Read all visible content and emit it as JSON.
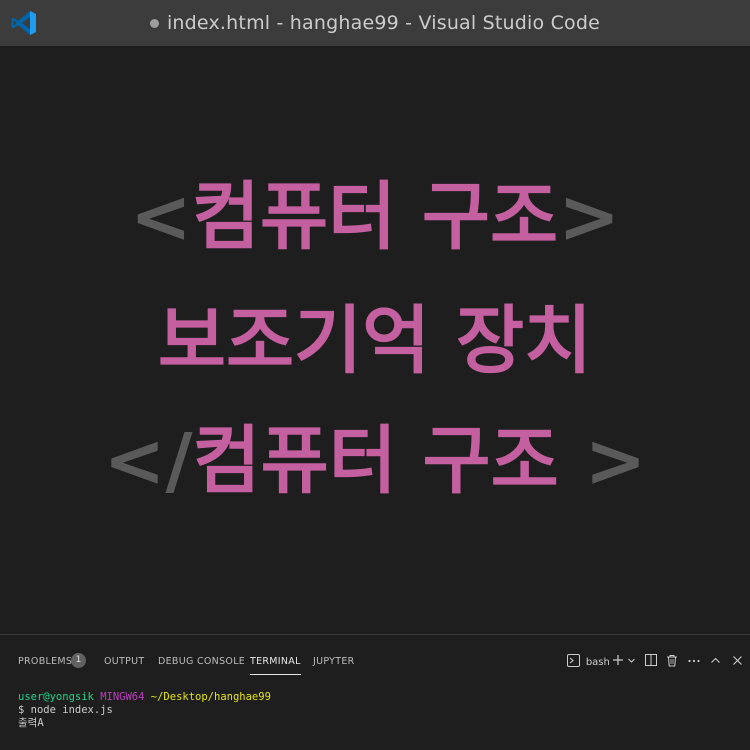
{
  "window": {
    "title": "index.html - hanghae99 - Visual Studio Code"
  },
  "editor": {
    "line1": {
      "open": "<",
      "text": "컴퓨터 구조",
      "close": ">"
    },
    "line2": {
      "text": "보조기억 장치"
    },
    "line3": {
      "open": "</",
      "text": "컴퓨터 구조",
      "close": " >"
    }
  },
  "panel": {
    "tabs": [
      {
        "label": "PROBLEMS"
      },
      {
        "label": "OUTPUT"
      },
      {
        "label": "DEBUG CONSOLE"
      },
      {
        "label": "TERMINAL"
      },
      {
        "label": "JUPYTER"
      }
    ],
    "problems_count": "1",
    "active_tab": "TERMINAL",
    "shell": "bash"
  },
  "terminal": {
    "user": "user@yongsik",
    "host": "MINGW64",
    "path": "~/Desktop/hanghae99",
    "command": "$ node index.js",
    "output": "출력A"
  },
  "colors": {
    "accent_pink": "#c45fa0",
    "bracket_gray": "#5a5a5a",
    "editor_bg": "#1e1e1e",
    "titlebar_bg": "#3c3c3c"
  },
  "icons": [
    "vscode-logo",
    "unsaved-dot-icon",
    "terminal-icon",
    "plus-icon",
    "chevron-down-icon",
    "split-icon",
    "trash-icon",
    "more-icon",
    "chevron-up-icon",
    "close-icon"
  ]
}
